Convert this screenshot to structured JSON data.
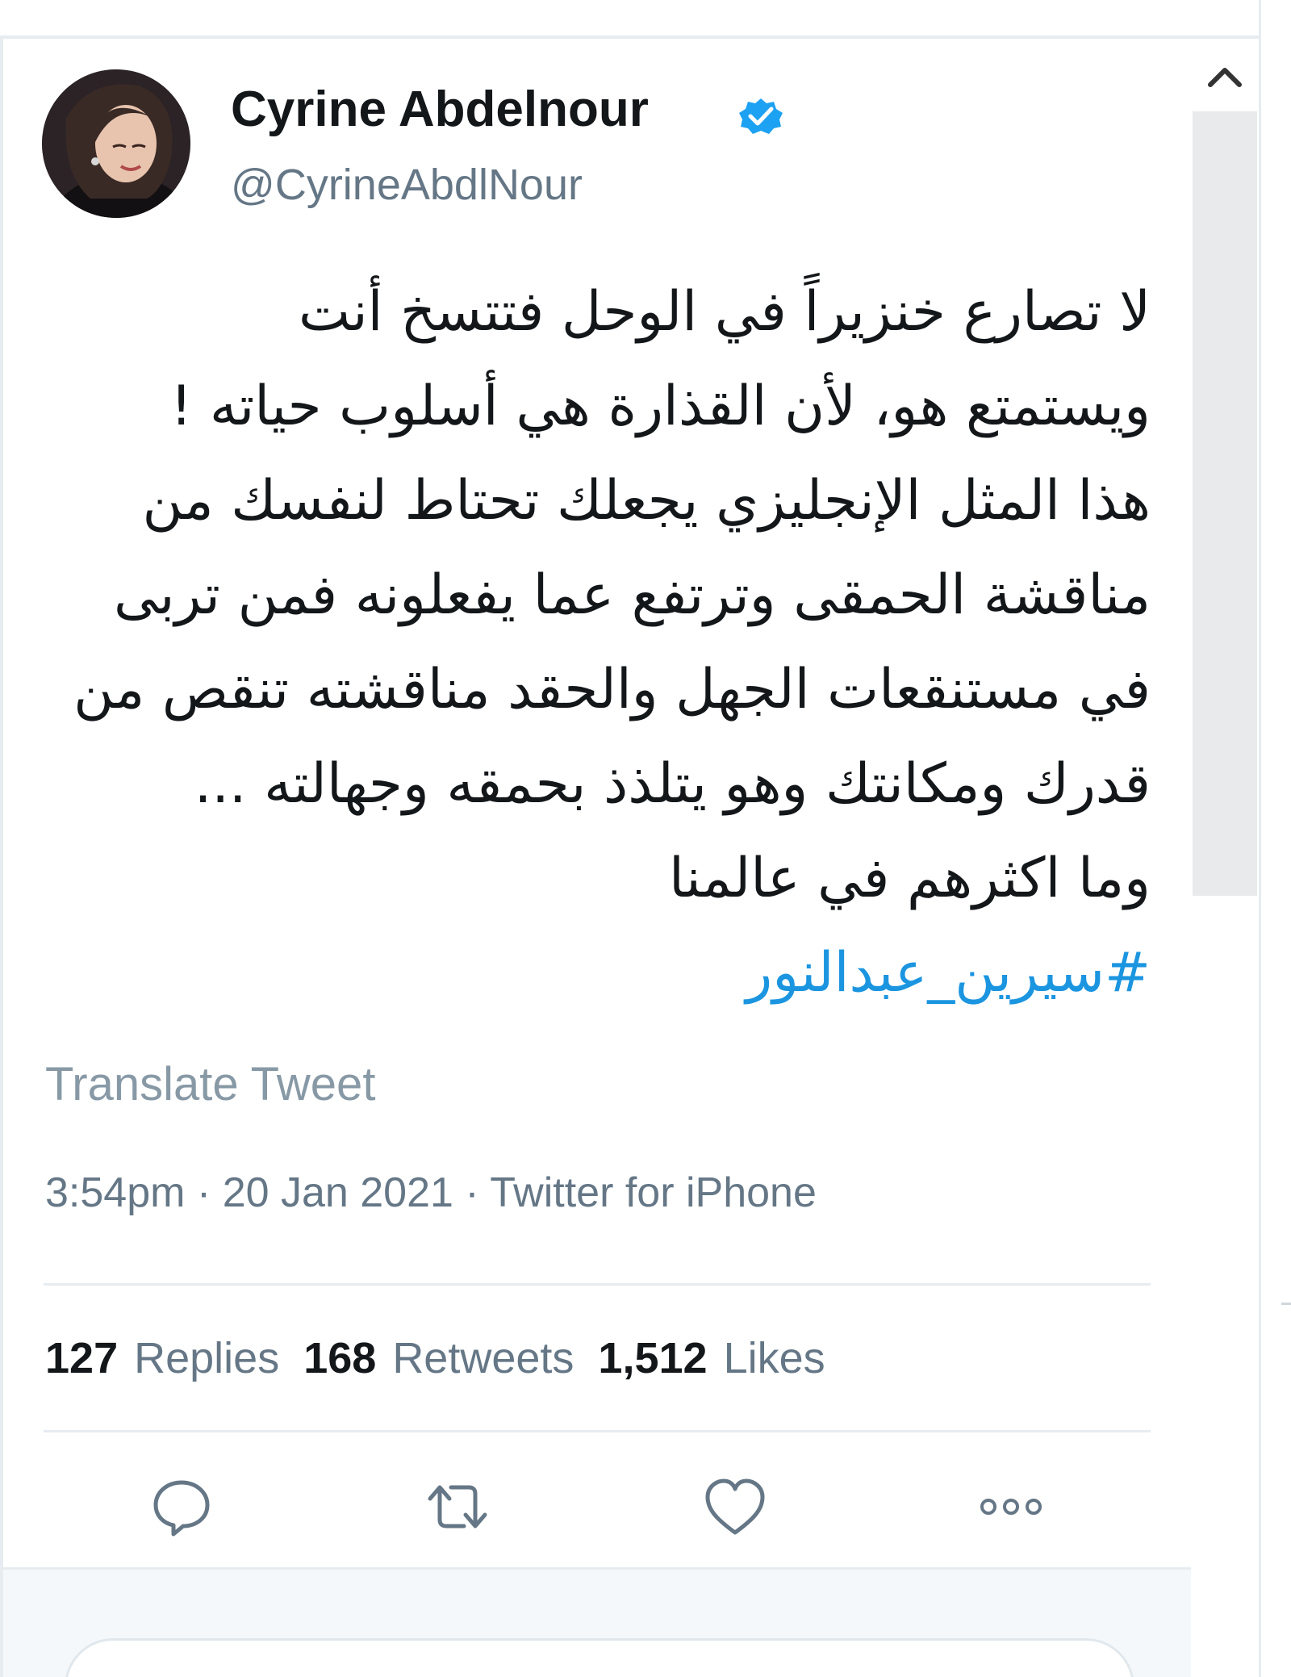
{
  "tweet": {
    "author_name": "Cyrine Abdelnour",
    "handle": "@CyrineAbdlNour",
    "verified_icon": "verified-badge-icon",
    "text_lines": [
      "لا تصارع خنزيراً في الوحل فتتسخ أنت",
      "ويستمتع هو، لأن القذارة هي أسلوب حياته !",
      "هذا المثل الإنجليزي يجعلك تحتاط لنفسك من",
      "مناقشة الحمقى وترتفع عما يفعلونه فمن تربى",
      "في مستنقعات الجهل والحقد مناقشته تنقص من",
      "قدرك ومكانتك وهو يتلذذ بحمقه وجهالته ...",
      "وما اكثرهم في عالمنا"
    ],
    "hashtag": "#سيرين_عبدالنور",
    "translate_label": "Translate Tweet",
    "time": "3:54pm",
    "date": "20 Jan 2021",
    "separator": "·",
    "source": "Twitter for iPhone"
  },
  "stats": {
    "replies_count": "127",
    "replies_label": "Replies",
    "retweets_count": "168",
    "retweets_label": "Retweets",
    "likes_count": "1,512",
    "likes_label": "Likes"
  },
  "actions": [
    "reply-icon",
    "retweet-icon",
    "like-icon",
    "more-icon"
  ],
  "colors": {
    "text": "#14171a",
    "secondary": "#657786",
    "link": "#1b95e0",
    "verified": "#1da1f2",
    "border": "#e6ecf0"
  }
}
